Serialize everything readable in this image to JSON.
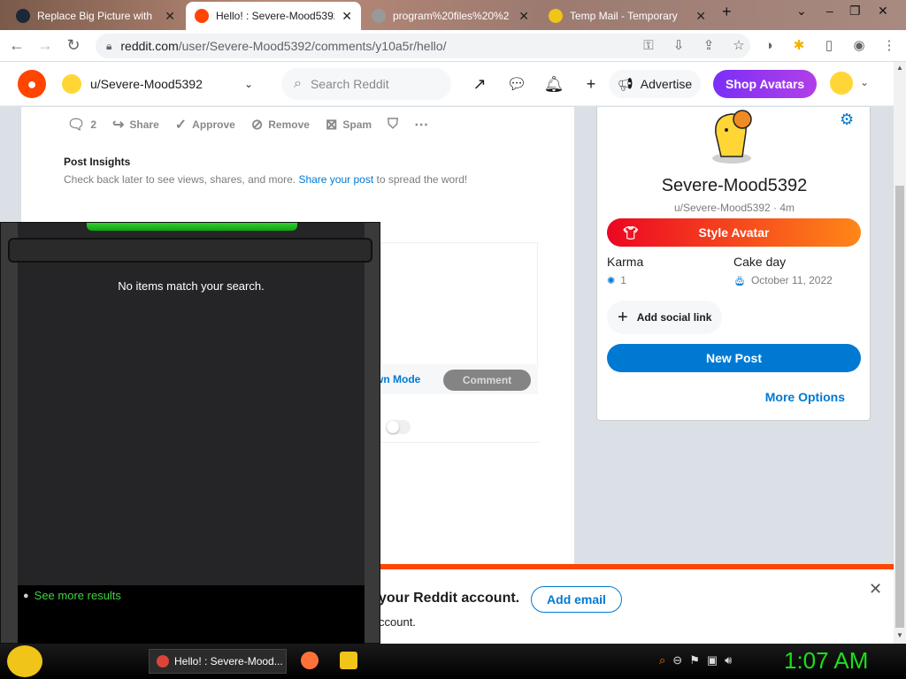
{
  "browser": {
    "tabs": [
      {
        "title": "Replace Big Picture with",
        "active": false
      },
      {
        "title": "Hello! : Severe-Mood5392",
        "active": true
      },
      {
        "title": "program%20files%20%2",
        "active": false
      },
      {
        "title": "Temp Mail - Temporary",
        "active": false
      }
    ],
    "url_host": "reddit.com",
    "url_path": "/user/Severe-Mood5392/comments/y10a5r/hello/"
  },
  "header": {
    "user_menu_label": "u/Severe-Mood5392",
    "search_placeholder": "Search Reddit",
    "advertise_label": "Advertise",
    "shop_label": "Shop Avatars"
  },
  "post": {
    "comment_count": "2",
    "share_label": "Share",
    "approve_label": "Approve",
    "remove_label": "Remove",
    "spam_label": "Spam",
    "insights_title": "Post Insights",
    "insights_text_before": "Check back later to see views, shares, and more. ",
    "insights_link": "Share your post",
    "insights_text_after": " to spread the word!",
    "markdown_mode_label": "wn Mode",
    "comment_button_label": "Comment"
  },
  "profile": {
    "name": "Severe-Mood5392",
    "subtitle": "u/Severe-Mood5392 · 4m",
    "style_avatar_label": "Style Avatar",
    "karma_label": "Karma",
    "karma_value": "1",
    "cake_day_label": "Cake day",
    "cake_day_value": "October 11, 2022",
    "social_link_label": "Add social link",
    "new_post_label": "New Post",
    "more_options_label": "More Options"
  },
  "banner": {
    "title": "your Reddit account.",
    "subtitle": "ccount.",
    "add_email_label": "Add email"
  },
  "overlay": {
    "message": "No items match your search.",
    "see_more_label": "See more results"
  },
  "taskbar": {
    "task_label": "Hello! : Severe-Mood...",
    "clock": "1:07 AM"
  }
}
